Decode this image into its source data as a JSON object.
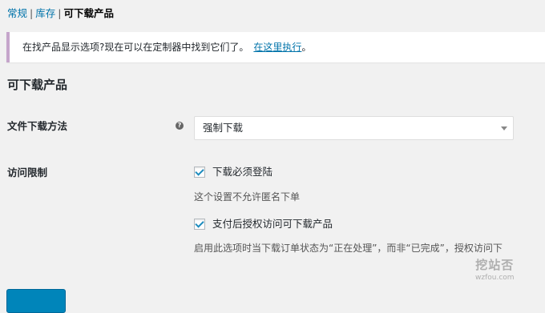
{
  "subnav": {
    "general": "常规",
    "inventory": "库存",
    "downloadable": "可下载产品",
    "separator": "|"
  },
  "notice": {
    "text": "在找产品显示选项?现在可以在定制器中找到它们了。",
    "link": "在这里执行",
    "trailing": "。",
    "border_color": "#c5a5cb"
  },
  "section": {
    "title": "可下载产品"
  },
  "download_method": {
    "label": "文件下载方法",
    "help_icon": "question-mark-icon",
    "selected": "强制下载"
  },
  "access_restriction": {
    "label": "访问限制",
    "options": [
      {
        "label": "下载必须登陆",
        "checked": true,
        "description": "这个设置不允许匿名下单"
      },
      {
        "label": "支付后授权访问可下载产品",
        "checked": true,
        "description": "启用此选项时当下载订单状态为“正在处理”，而非“已完成”，授权访问下"
      }
    ]
  },
  "colors": {
    "link": "#0073aa",
    "primary_button": "#0085ba",
    "checkmark": "#1e8cbe"
  },
  "watermark": {
    "title": "挖站否",
    "domain": "wzfou.com"
  }
}
